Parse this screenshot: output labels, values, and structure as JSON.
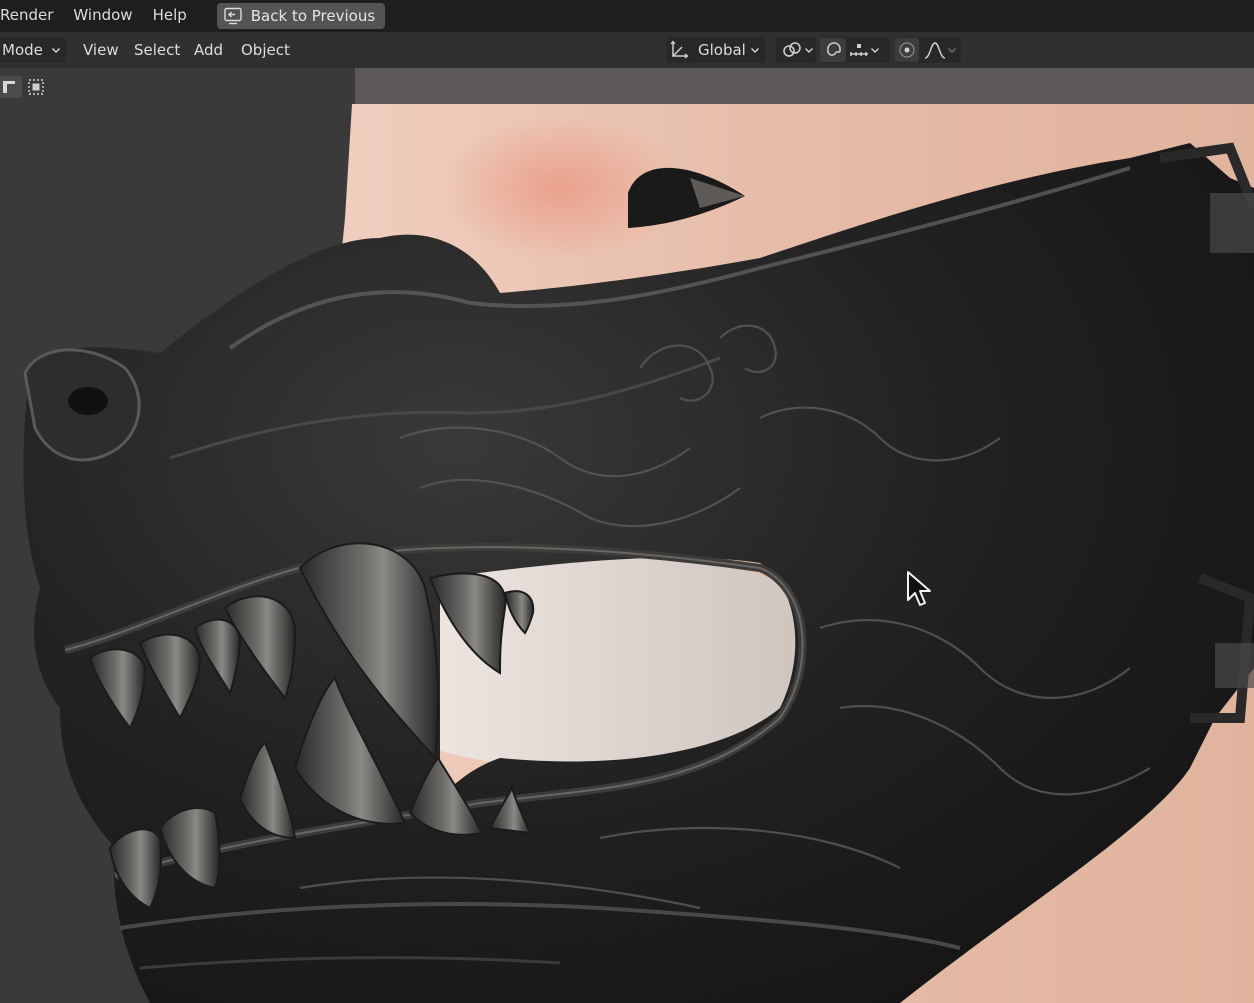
{
  "topbar": {
    "menus": [
      "Render",
      "Window",
      "Help"
    ],
    "back_button": "Back to Previous"
  },
  "header": {
    "mode": "Mode",
    "menus": [
      "View",
      "Select",
      "Add",
      "Object"
    ],
    "pivot": "Global"
  },
  "icons": {
    "back": "back-to-previous-icon",
    "transform_orientation": "transform-orientation-icon",
    "pivot_link": "pivot-point-icon",
    "snap": "snap-magnet-icon",
    "snap_target": "snap-increment-icon",
    "proportional": "proportional-edit-icon",
    "falloff": "falloff-curve-icon",
    "cursor": "mouse-cursor-icon"
  },
  "colors": {
    "topbar_bg": "#1e1e1e",
    "header_bg": "#303030",
    "viewport_bg": "#3a3a3a",
    "skin": "#e7c2b2",
    "mask": "#1c1b1b"
  }
}
